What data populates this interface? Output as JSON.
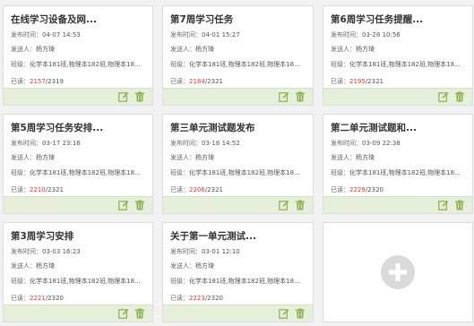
{
  "labels": {
    "publish_time": "发布时间：",
    "sender": "发送人：",
    "class": "班级：",
    "read": "已读："
  },
  "colors": {
    "read_count": "#e53935",
    "footer_bg": "#e6efd9",
    "icon_green": "#8bb04f"
  },
  "icons": {
    "edit": "edit-icon",
    "delete": "trash-icon",
    "add": "plus-icon"
  },
  "cards": [
    {
      "title": "在线学习设备及网...",
      "time": "04-07 14:53",
      "sender": "杨方琦",
      "classes": "化学本181班,物理本182班,物理本18...",
      "read": "2157",
      "total": "/2319"
    },
    {
      "title": "第7周学习任务",
      "time": "04-01 15:27",
      "sender": "杨方琦",
      "classes": "化学本181班,物理本182班,物理本18...",
      "read": "2184",
      "total": "/2321"
    },
    {
      "title": "第6周学习任务提醒...",
      "time": "03-28 10:56",
      "sender": "杨方琦",
      "classes": "化学本181班,物理本182班,物理本18...",
      "read": "2195",
      "total": "/2321"
    },
    {
      "title": "第5周学习任务安排...",
      "time": "03-17 23:16",
      "sender": "杨方琦",
      "classes": "化学本181班,物理本182班,物理本18...",
      "read": "2210",
      "total": "/2321"
    },
    {
      "title": "第三单元测试题发布",
      "time": "03-16 14:52",
      "sender": "杨方琦",
      "classes": "化学本181班,物理本182班,物理本18...",
      "read": "2206",
      "total": "/2321"
    },
    {
      "title": "第二单元测试题和...",
      "time": "03-09 22:38",
      "sender": "杨方琦",
      "classes": "化学本181班,物理本182班,物理本18...",
      "read": "2229",
      "total": "/2320"
    },
    {
      "title": "第3周学习安排",
      "time": "03-03 16:23",
      "sender": "杨方琦",
      "classes": "化学本181班,物理本182班,物理本18...",
      "read": "2221",
      "total": "/2320"
    },
    {
      "title": "关于第一单元测试...",
      "time": "03-01 12:10",
      "sender": "杨方琦",
      "classes": "化学本181班,物理本182班,物理本18...",
      "read": "2223",
      "total": "/2320"
    }
  ]
}
